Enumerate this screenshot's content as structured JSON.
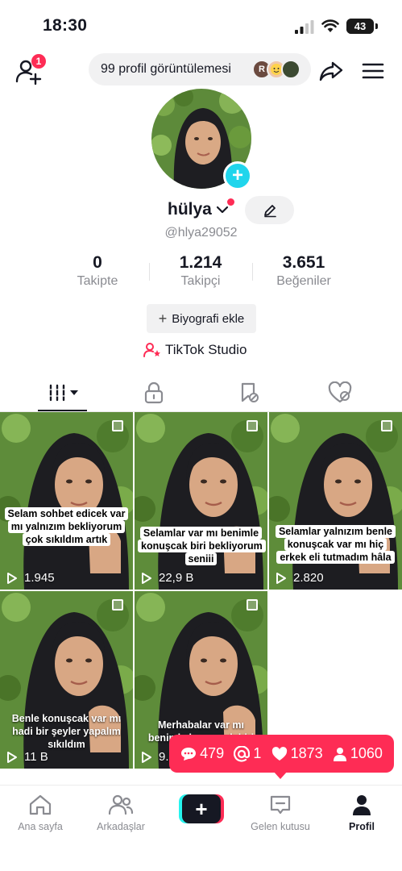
{
  "status_bar": {
    "time": "18:30",
    "battery": "43"
  },
  "top_bar": {
    "notification_count": "1",
    "profile_views": "99 profil görüntülemesi",
    "viewer_initial": "R"
  },
  "profile": {
    "username": "hülya",
    "handle": "@hlya29052",
    "stats": [
      {
        "value": "0",
        "label": "Takipte"
      },
      {
        "value": "1.214",
        "label": "Takipçi"
      },
      {
        "value": "3.651",
        "label": "Beğeniler"
      }
    ],
    "bio_button": "Biyografi ekle",
    "studio_label": "TikTok Studio"
  },
  "tabs": [
    {
      "name": "videos",
      "icon": "grid-icon"
    },
    {
      "name": "private",
      "icon": "lock-icon"
    },
    {
      "name": "favorites",
      "icon": "bookmark-icon"
    },
    {
      "name": "liked",
      "icon": "heart-icon"
    }
  ],
  "videos": [
    {
      "caption": "Selam sohbet edicek var mı yalnızım bekliyorum çok sıkıldım artık",
      "plays": "1.945"
    },
    {
      "caption": "Selamlar var mı benimle konuşcak biri bekliyorum seniii",
      "plays": "22,9 B"
    },
    {
      "caption": "Selamlar yalnızım benle konuşcak var mı hiç erkek eli tutmadım hâla",
      "plays": "2.820"
    },
    {
      "caption": "Benle konuşcak var mı hadi bir şeyler yapalım sıkıldım",
      "plays": "11 B"
    },
    {
      "caption": "Merhabalar var mı benimle konuşcak biri bekliyorum",
      "plays": "9."
    }
  ],
  "popup": {
    "comments": "479",
    "mentions": "1",
    "likes": "1873",
    "followers": "1060"
  },
  "bottom_nav": [
    {
      "label": "Ana sayfa"
    },
    {
      "label": "Arkadaşlar"
    },
    {
      "label": "Gelen kutusu"
    },
    {
      "label": "Profil"
    }
  ],
  "colors": {
    "accent": "#fe2c55",
    "cyan": "#25f4ee",
    "plus": "#20d5ec"
  }
}
